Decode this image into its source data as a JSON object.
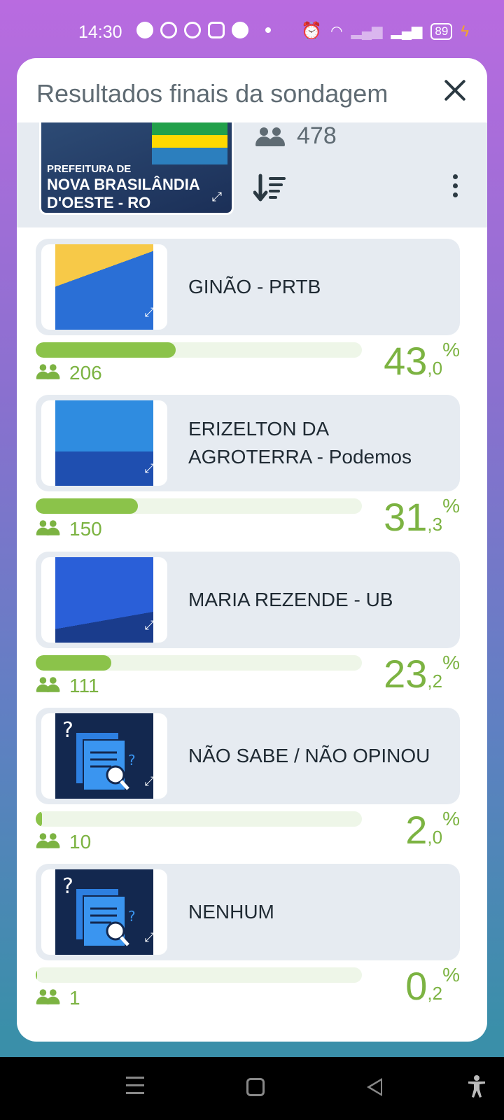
{
  "status_bar": {
    "time": "14:30",
    "battery": "89"
  },
  "poll": {
    "title": "Resultados finais da sondagem",
    "banner_line1": "PREFEITURA DE",
    "banner_line2": "NOVA BRASILÂNDIA D'OESTE - RO",
    "total_votes": "478"
  },
  "options": [
    {
      "label": "GINÃO - PRTB",
      "votes": "206",
      "pct_int": "43",
      "pct_dec": ",0",
      "pct_sign": "%",
      "fraction": 0.43,
      "thumb_color": "#2a6fd6"
    },
    {
      "label": "ERIZELTON DA AGROTERRA - Podemos",
      "votes": "150",
      "pct_int": "31",
      "pct_dec": ",3",
      "pct_sign": "%",
      "fraction": 0.313,
      "thumb_color": "#1f63c4"
    },
    {
      "label": "MARIA REZENDE - UB",
      "votes": "111",
      "pct_int": "23",
      "pct_dec": ",2",
      "pct_sign": "%",
      "fraction": 0.232,
      "thumb_color": "#1d5fd0"
    },
    {
      "label": "NÃO SABE / NÃO OPINOU",
      "votes": "10",
      "pct_int": "2",
      "pct_dec": ",0",
      "pct_sign": "%",
      "fraction": 0.02,
      "thumb_color": "#13284f"
    },
    {
      "label": "NENHUM",
      "votes": "1",
      "pct_int": "0",
      "pct_dec": ",2",
      "pct_sign": "%",
      "fraction": 0.002,
      "thumb_color": "#13284f"
    }
  ],
  "colors": {
    "accent": "#7cb342",
    "bar": "#8bc34a",
    "track": "#eef6e8",
    "option_bg": "#e6ebf1"
  }
}
